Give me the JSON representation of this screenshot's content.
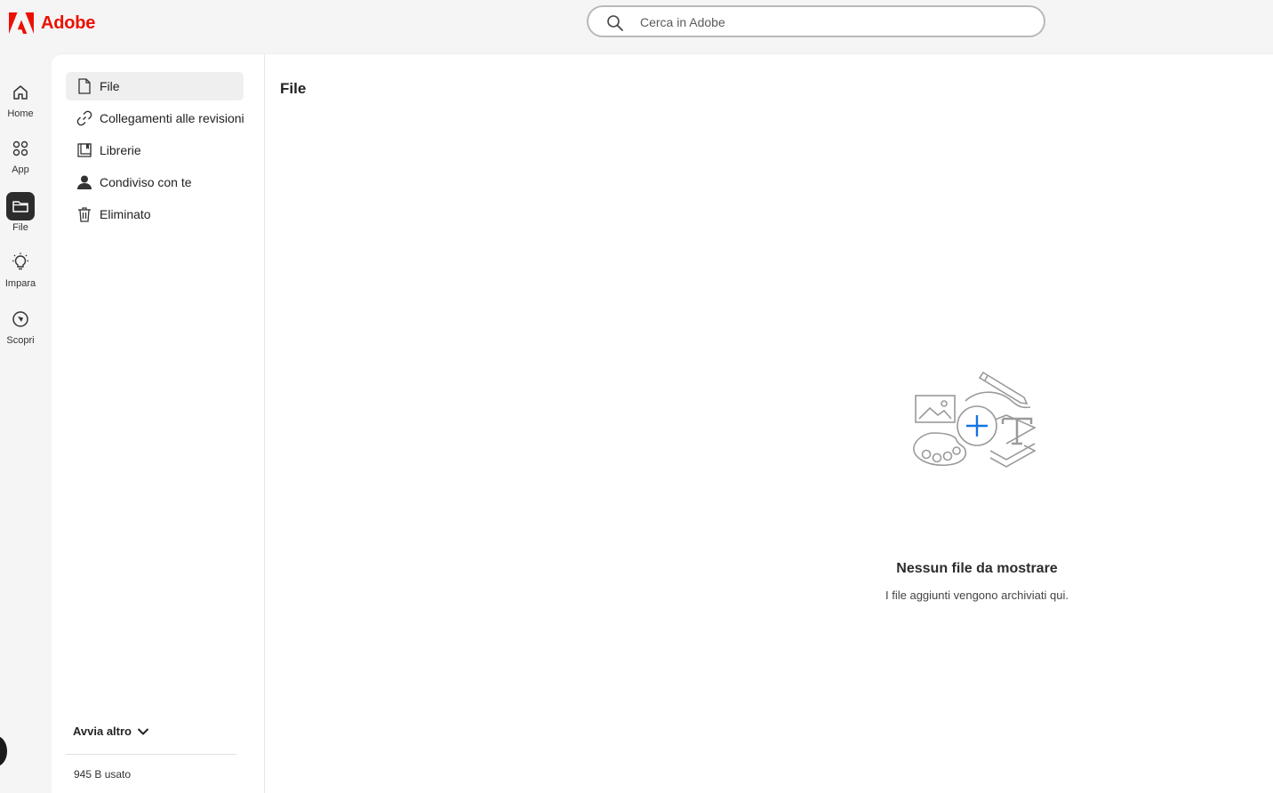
{
  "brand": {
    "name": "Adobe",
    "color": "#eb1000"
  },
  "search": {
    "placeholder": "Cerca in Adobe",
    "value": ""
  },
  "rail": {
    "items": [
      {
        "label": "Home",
        "icon": "home-icon",
        "active": false
      },
      {
        "label": "App",
        "icon": "apps-grid-icon",
        "active": false
      },
      {
        "label": "File",
        "icon": "folder-icon",
        "active": true
      },
      {
        "label": "Impara",
        "icon": "lightbulb-icon",
        "active": false
      },
      {
        "label": "Scopri",
        "icon": "compass-icon",
        "active": false
      }
    ]
  },
  "sidenav": {
    "items": [
      {
        "label": "File",
        "icon": "document-icon",
        "active": true
      },
      {
        "label": "Collegamenti alle revisioni",
        "icon": "link-icon",
        "active": false
      },
      {
        "label": "Librerie",
        "icon": "library-icon",
        "active": false
      },
      {
        "label": "Condiviso con te",
        "icon": "user-icon",
        "active": false
      },
      {
        "label": "Eliminato",
        "icon": "trash-icon",
        "active": false
      }
    ],
    "more_label": "Avvia altro",
    "storage_label": "945 B usato"
  },
  "main": {
    "title": "File",
    "empty_state": {
      "title": "Nessun file da mostrare",
      "subtitle": "I file aggiunti vengono archiviati qui."
    }
  },
  "colors": {
    "accent_blue": "#1473e6",
    "active_rail": "#2c2c2c"
  }
}
